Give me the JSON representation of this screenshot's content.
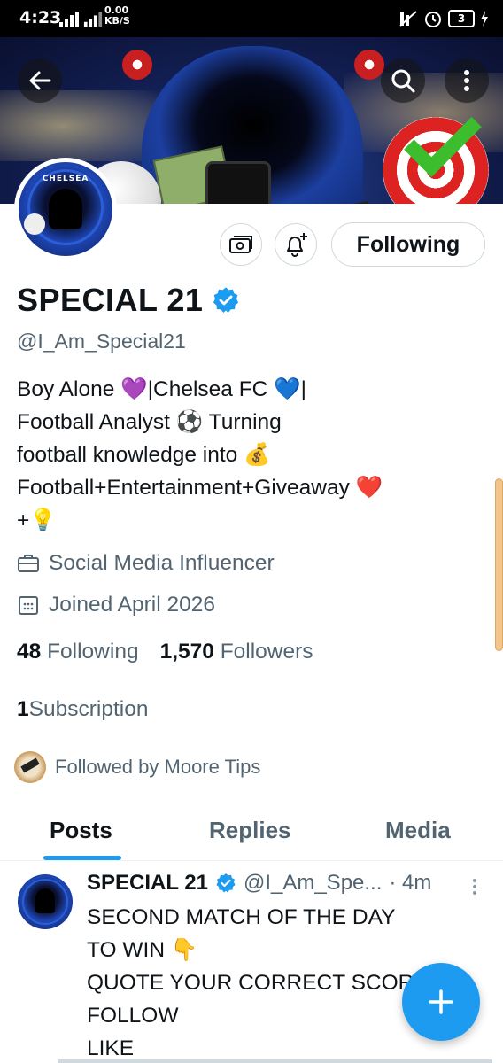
{
  "status_bar": {
    "time": "4:23",
    "net_speed_value": "0.00",
    "net_speed_unit": "KB/S",
    "battery": "3"
  },
  "profile": {
    "display_name": "SPECIAL 21",
    "handle": "@I_Am_Special21",
    "bio": [
      "Boy Alone 💜|Chelsea FC 💙|",
      "Football Analyst ⚽  Turning",
      "football knowledge into 💰",
      "Football+Entertainment+Giveaway  ❤️",
      "+💡"
    ],
    "category": "Social Media Influencer",
    "joined": "Joined April 2026",
    "following_count": "48",
    "following_label": "Following",
    "followers_count": "1,570",
    "followers_label": "Followers",
    "subscription_count": "1",
    "subscription_label": "Subscription",
    "followed_by": "Followed by Moore Tips",
    "avatar_text": "CHELSEA"
  },
  "actions": {
    "following_button": "Following"
  },
  "tabs": [
    {
      "label": "Posts",
      "active": true
    },
    {
      "label": "Replies",
      "active": false
    },
    {
      "label": "Media",
      "active": false
    }
  ],
  "post": {
    "name": "SPECIAL 21",
    "handle": "@I_Am_Spe...",
    "time": "· 4m",
    "lines": [
      "SECOND MATCH OF THE DAY",
      "TO WIN 👇",
      "QUOTE YOUR CORRECT SCORE",
      "FOLLOW",
      "LIKE"
    ]
  },
  "colors": {
    "accent": "#1d9bf0",
    "text_primary": "#0f1419",
    "text_secondary": "#536471",
    "border": "#cfd9de"
  }
}
